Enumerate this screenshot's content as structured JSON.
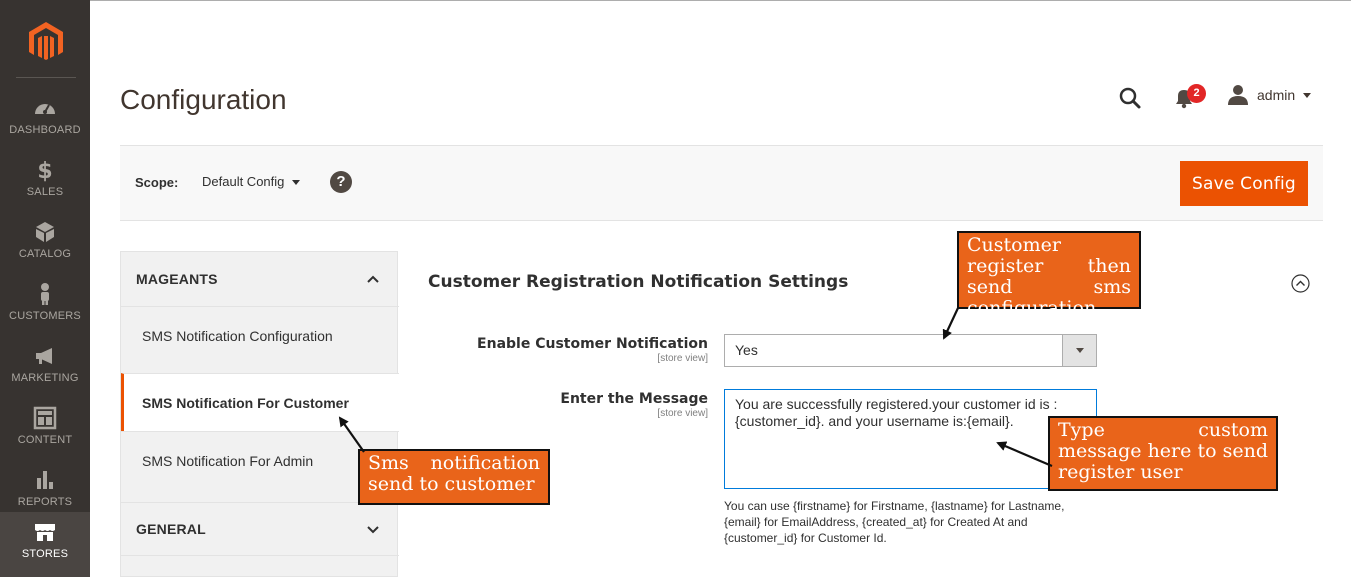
{
  "sidebar": {
    "items": [
      {
        "label": "DASHBOARD",
        "icon": "dashboard-icon"
      },
      {
        "label": "SALES",
        "icon": "dollar-icon"
      },
      {
        "label": "CATALOG",
        "icon": "cube-icon"
      },
      {
        "label": "CUSTOMERS",
        "icon": "person-icon"
      },
      {
        "label": "MARKETING",
        "icon": "megaphone-icon"
      },
      {
        "label": "CONTENT",
        "icon": "layout-icon"
      },
      {
        "label": "REPORTS",
        "icon": "bar-chart-icon"
      },
      {
        "label": "STORES",
        "icon": "store-icon"
      }
    ],
    "active": "STORES"
  },
  "header": {
    "title": "Configuration",
    "notification_count": "2",
    "user": "admin"
  },
  "scope": {
    "label": "Scope:",
    "value": "Default Config",
    "help": "?",
    "save_label": "Save Config"
  },
  "tabs": {
    "group1": "MAGEANTS",
    "items": [
      "SMS Notification Configuration",
      "SMS Notification For Customer",
      "SMS Notification For Admin"
    ],
    "group2": "GENERAL"
  },
  "section": {
    "title": "Customer Registration Notification Settings",
    "fields": [
      {
        "label": "Enable Customer Notification",
        "scope": "[store view]",
        "value": "Yes"
      },
      {
        "label": "Enter the Message",
        "scope": "[store view]",
        "value": "You are successfully registered.your customer id is : {customer_id}. and your username is:{email}."
      }
    ],
    "note": "You can use {firstname} for Firstname, {lastname} for Lastname, {email} for EmailAddress, {created_at} for Created At and {customer_id} for Customer Id."
  },
  "callouts": {
    "top": "Customer register then send sms configuration",
    "left": "Sms notification send to customer",
    "right": "Type custom message here to send register user"
  },
  "colors": {
    "sidebar_bg": "#373330",
    "accent": "#eb5202",
    "callout": "#e9641a"
  }
}
